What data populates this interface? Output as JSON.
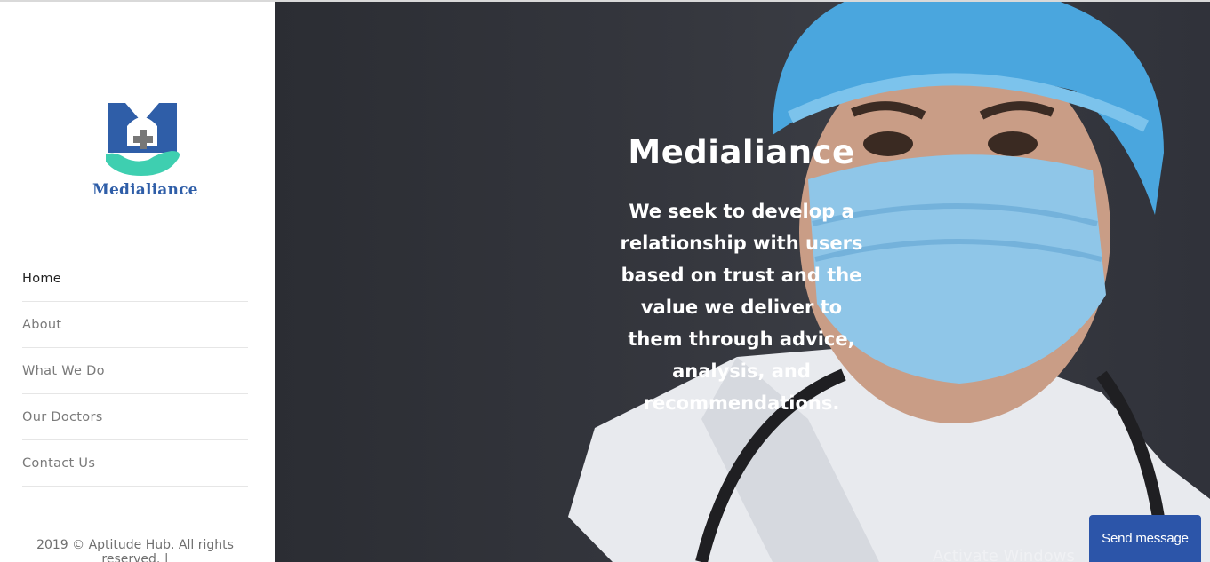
{
  "brand": {
    "name": "Medialiance",
    "logo_icon": "medical-hand-cross-logo",
    "colors": {
      "primary_blue": "#2f5ea8",
      "accent_teal": "#3ecfb0"
    }
  },
  "nav": {
    "items": [
      {
        "label": "Home",
        "active": true
      },
      {
        "label": "About",
        "active": false
      },
      {
        "label": "What We Do",
        "active": false
      },
      {
        "label": "Our Doctors",
        "active": false
      },
      {
        "label": "Contact Us",
        "active": false
      }
    ]
  },
  "footer": {
    "text": "2019 © Aptitude Hub. All rights reserved. |"
  },
  "hero": {
    "title": "Medialiance",
    "text": "We seek to develop a relationship with users based on trust and the value we deliver to them through advice, analysis, and recommendations."
  },
  "watermark": {
    "text": "Activate Windows"
  },
  "chat": {
    "button_label": "Send message",
    "color": "#2c55a9"
  }
}
